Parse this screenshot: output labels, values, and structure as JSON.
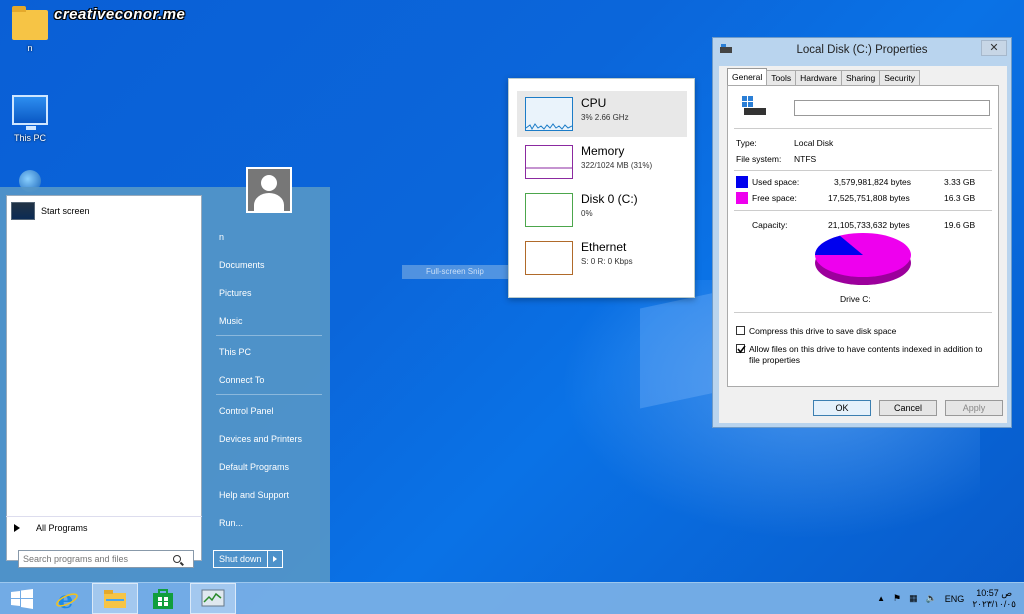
{
  "watermark": "creativeconor.me",
  "desktop": {
    "icons": [
      {
        "label": "n",
        "icon": "folder-icon"
      },
      {
        "label": "This PC",
        "icon": "computer-icon"
      },
      {
        "label": "",
        "icon": "network-icon"
      }
    ]
  },
  "start_menu": {
    "pinned": [
      {
        "label": "Start screen",
        "icon": "start-screen-icon"
      }
    ],
    "all_programs_label": "All Programs",
    "search": {
      "placeholder": "Search programs and files",
      "value": ""
    },
    "user_name": "n",
    "right_items": [
      {
        "label": "Documents"
      },
      {
        "label": "Pictures"
      },
      {
        "label": "Music"
      },
      {
        "label": "This PC"
      },
      {
        "label": "Connect To"
      },
      {
        "label": "Control Panel"
      },
      {
        "label": "Devices and Printers"
      },
      {
        "label": "Default Programs"
      },
      {
        "label": "Help and Support"
      },
      {
        "label": "Run..."
      }
    ],
    "shutdown_label": "Shut down"
  },
  "snip_label": "Full-screen Snip",
  "performance": [
    {
      "name": "CPU",
      "detail": "3%  2.66 GHz",
      "color": "#1c7cc7",
      "selected": true
    },
    {
      "name": "Memory",
      "detail": "322/1024 MB (31%)",
      "color": "#8b2aa0",
      "selected": false
    },
    {
      "name": "Disk 0 (C:)",
      "detail": "0%",
      "color": "#4ca64c",
      "selected": false
    },
    {
      "name": "Ethernet",
      "detail": "S: 0  R: 0 Kbps",
      "color": "#b06a2a",
      "selected": false
    }
  ],
  "properties": {
    "title": "Local Disk (C:) Properties",
    "close_label": "✕",
    "tabs": [
      "General",
      "Tools",
      "Hardware",
      "Sharing",
      "Security"
    ],
    "name_value": "",
    "type_label": "Type:",
    "type_value": "Local Disk",
    "fs_label": "File system:",
    "fs_value": "NTFS",
    "used_label": "Used space:",
    "used_bytes": "3,579,981,824 bytes",
    "used_size": "3.33 GB",
    "used_color": "#0000ee",
    "free_label": "Free space:",
    "free_bytes": "17,525,751,808 bytes",
    "free_size": "16.3 GB",
    "free_color": "#ee00ee",
    "cap_label": "Capacity:",
    "cap_bytes": "21,105,733,632 bytes",
    "cap_size": "19.6 GB",
    "used_fraction": 0.17,
    "drive_label": "Drive C:",
    "compress_label": "Compress this drive to save disk space",
    "compress_checked": false,
    "index_label": "Allow files on this drive to have contents indexed in addition to file properties",
    "index_checked": true,
    "ok": "OK",
    "cancel": "Cancel",
    "apply": "Apply"
  },
  "taskbar": {
    "apps": [
      "internet-explorer-icon",
      "file-explorer-icon",
      "store-icon",
      "task-manager-icon"
    ],
    "tray": {
      "lang": "ENG",
      "time": "10:57 ص",
      "date": "٢٠٢٣/١٠/٠٥"
    }
  }
}
